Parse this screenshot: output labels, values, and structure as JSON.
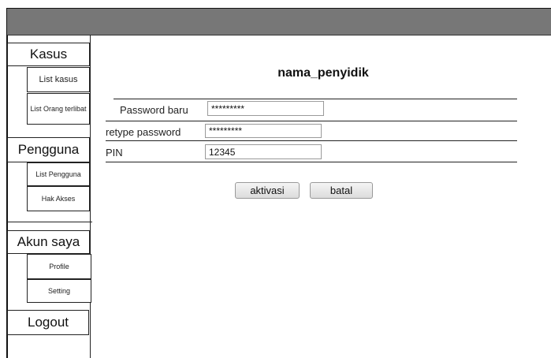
{
  "sidebar": {
    "kasus": {
      "label": "Kasus",
      "items": [
        "List kasus",
        "List Orang terlibat"
      ]
    },
    "pengguna": {
      "label": "Pengguna",
      "items": [
        "List Pengguna",
        "Hak Akses"
      ]
    },
    "akun": {
      "label": "Akun saya",
      "items": [
        "Profile",
        "Setting"
      ]
    },
    "logout": "Logout"
  },
  "form": {
    "title": "nama_penyidik",
    "fields": [
      {
        "label": "Password baru",
        "value": "*********"
      },
      {
        "label": "retype password",
        "value": "*********"
      },
      {
        "label": "PIN",
        "value": "12345"
      }
    ],
    "buttons": {
      "activate": "aktivasi",
      "cancel": "batal"
    }
  },
  "colors": {
    "topbar": "#777777",
    "border": "#222222"
  }
}
